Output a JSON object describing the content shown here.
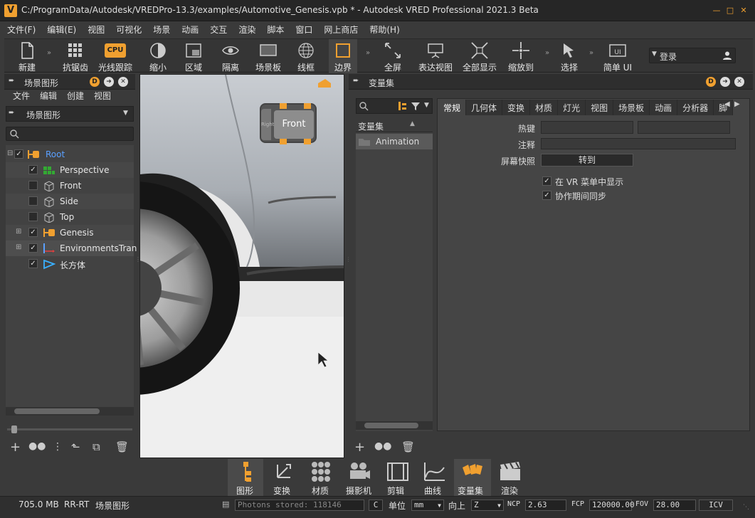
{
  "window": {
    "title": "C:/ProgramData/Autodesk/VREDPro-13.3/examples/Automotive_Genesis.vpb * - Autodesk VRED Professional 2021.3 Beta",
    "app_icon": "V"
  },
  "menu": [
    "文件(F)",
    "编辑(E)",
    "视图",
    "可视化",
    "场景",
    "动画",
    "交互",
    "渲染",
    "脚本",
    "窗口",
    "网上商店",
    "帮助(H)"
  ],
  "toolbar": {
    "buttons": [
      "新建",
      "抗锯齿",
      "光线跟踪",
      "缩小",
      "区域",
      "隔离",
      "场景板",
      "线框",
      "边界",
      "全屏",
      "表达视图",
      "全部显示",
      "缩放到",
      "选择",
      "简单 UI"
    ],
    "cpu_badge": "CPU",
    "login": "登录"
  },
  "scene_panel": {
    "title": "场景图形",
    "menu": [
      "文件",
      "编辑",
      "创建",
      "视图"
    ],
    "combo": "场景图形",
    "tree": [
      {
        "label": "Root",
        "checked": true
      },
      {
        "label": "Perspective",
        "checked": true
      },
      {
        "label": "Front",
        "checked": false
      },
      {
        "label": "Side",
        "checked": false
      },
      {
        "label": "Top",
        "checked": false
      },
      {
        "label": "Genesis",
        "checked": true
      },
      {
        "label": "EnvironmentsTran",
        "checked": true
      },
      {
        "label": "长方体",
        "checked": true
      }
    ]
  },
  "viewport": {
    "badge": "Front",
    "badge_small": "Right"
  },
  "variant_panel": {
    "title": "变量集",
    "list_header": "变量集",
    "list_items": [
      "Animation"
    ],
    "tabs": [
      "常规",
      "几何体",
      "变换",
      "材质",
      "灯光",
      "视图",
      "场景板",
      "动画",
      "分析器",
      "脚"
    ],
    "hotkey_label": "热键",
    "comment_label": "注释",
    "snapshot_label": "屏幕快照",
    "goto_button": "转到",
    "checkbox1": "在 VR 菜单中显示",
    "checkbox2": "协作期间同步"
  },
  "bottom_modules": [
    "图形",
    "变换",
    "材质",
    "摄影机",
    "剪辑",
    "曲线",
    "变量集",
    "渲染"
  ],
  "status": {
    "memory": "705.0 MB",
    "mode": "RR-RT",
    "context": "场景图形",
    "photons": "Photons stored: 118146",
    "c_btn": "C",
    "unit_label": "单位",
    "unit_value": "mm",
    "up_label": "向上",
    "up_value": "Z",
    "ncp_label": "NCP",
    "ncp_value": "2.63",
    "fcp_label": "FCP",
    "fcp_value": "120000.00",
    "fov_label": "FOV",
    "fov_value": "28.00",
    "icv": "ICV"
  },
  "colors": {
    "accent": "#f0a030",
    "background": "#3a3a3a",
    "root_text": "#5aa0ff"
  }
}
